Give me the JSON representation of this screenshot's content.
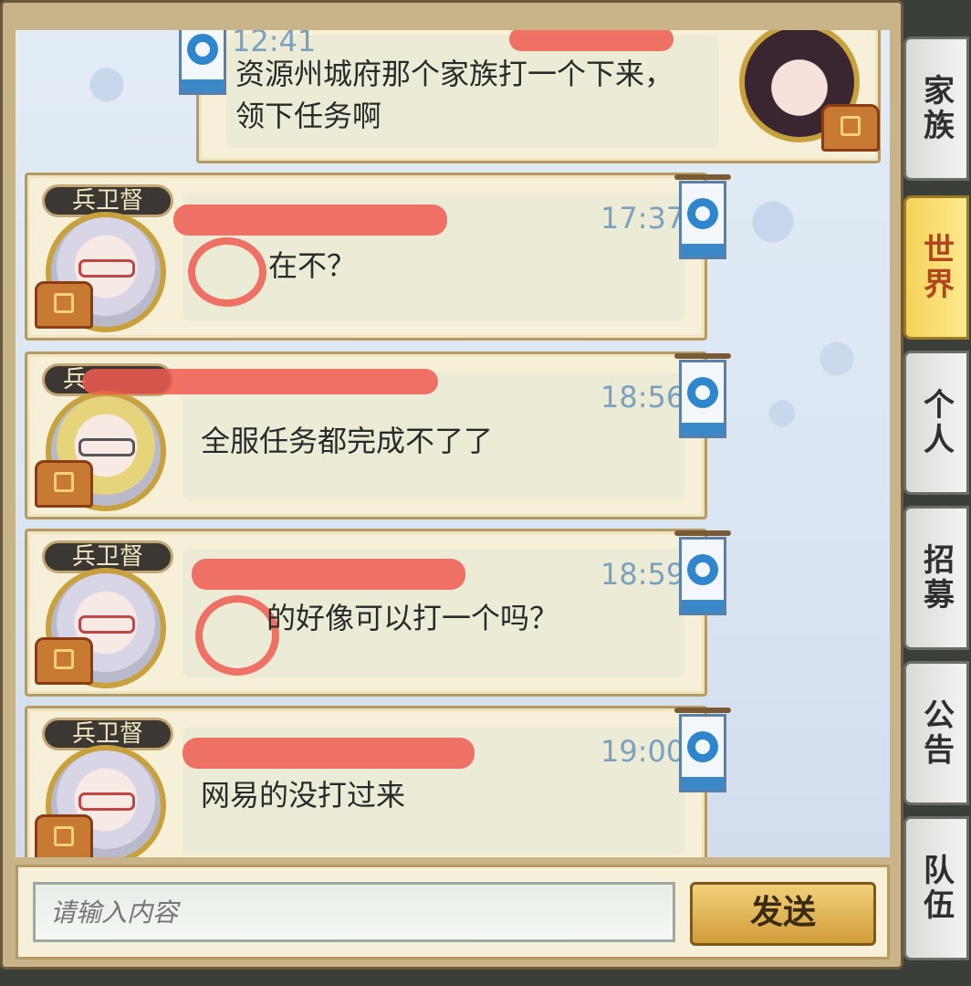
{
  "messages": [
    {
      "time": "12:41",
      "text": "资源州城府那个家族打一个下来，\n领下任务啊",
      "rank": ""
    },
    {
      "time": "17:37",
      "text": "在不？",
      "rank": "兵卫督"
    },
    {
      "time": "18:56",
      "text": "全服任务都完成不了了",
      "rank": "兵"
    },
    {
      "time": "18:59",
      "text": "的好像可以打一个吗？",
      "rank": "兵卫督"
    },
    {
      "time": "19:00",
      "text": "网易的没打过来",
      "rank": "兵卫督"
    }
  ],
  "tabs": [
    "家族",
    "世界",
    "个人",
    "招募",
    "公告",
    "队伍"
  ],
  "active_tab": "世界",
  "input": {
    "placeholder": "请输入内容"
  },
  "send_label": "发送",
  "colors": {
    "accent_gold": "#d19d3a",
    "active_tab": "#f4d35a",
    "time_blue": "#7aa2c0",
    "redaction": "#f05a50"
  }
}
